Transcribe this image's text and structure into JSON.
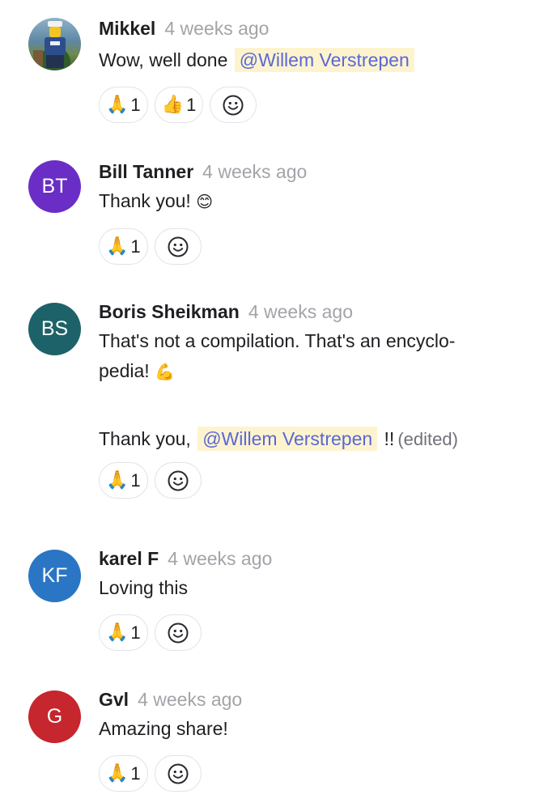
{
  "comments": [
    {
      "author": "Mikkel",
      "time": "4 weeks ago",
      "avatar": {
        "type": "photo",
        "color": "#3f6f88"
      },
      "text_prefix": "Wow, well done ",
      "mention": "@Willem Verstrepen",
      "reactions": [
        {
          "emoji": "🙏",
          "count": "1"
        },
        {
          "emoji": "👍",
          "count": "1"
        }
      ]
    },
    {
      "author": "Bill Tanner",
      "time": "4 weeks ago",
      "avatar": {
        "type": "initials",
        "initials": "BT",
        "color": "#6a2ec6"
      },
      "text": "Thank you! ",
      "text_emoji": "😊",
      "reactions": [
        {
          "emoji": "🙏",
          "count": "1"
        }
      ]
    },
    {
      "author": "Boris Sheikman",
      "time": "4 weeks ago",
      "avatar": {
        "type": "initials",
        "initials": "BS",
        "color": "#1e6269"
      },
      "text_line1": "That's not a compilation. That's an encyclo-",
      "text_line2": "pedia! ",
      "text_emoji": "💪",
      "text2_prefix": "Thank you, ",
      "mention": "@Willem Verstrepen",
      "text2_suffix": " !!",
      "edited": "(edited)",
      "reactions": [
        {
          "emoji": "🙏",
          "count": "1"
        }
      ]
    },
    {
      "author": "karel F",
      "time": "4 weeks ago",
      "avatar": {
        "type": "initials",
        "initials": "KF",
        "color": "#2a76c4"
      },
      "text": "Loving this",
      "reactions": [
        {
          "emoji": "🙏",
          "count": "1"
        }
      ]
    },
    {
      "author": "Gvl",
      "time": "4 weeks ago",
      "avatar": {
        "type": "initials",
        "initials": "G",
        "color": "#c6262e"
      },
      "text": "Amazing share!",
      "reactions": [
        {
          "emoji": "🙏",
          "count": "1"
        }
      ]
    }
  ],
  "icons": {
    "add_reaction": "smiley-icon"
  }
}
